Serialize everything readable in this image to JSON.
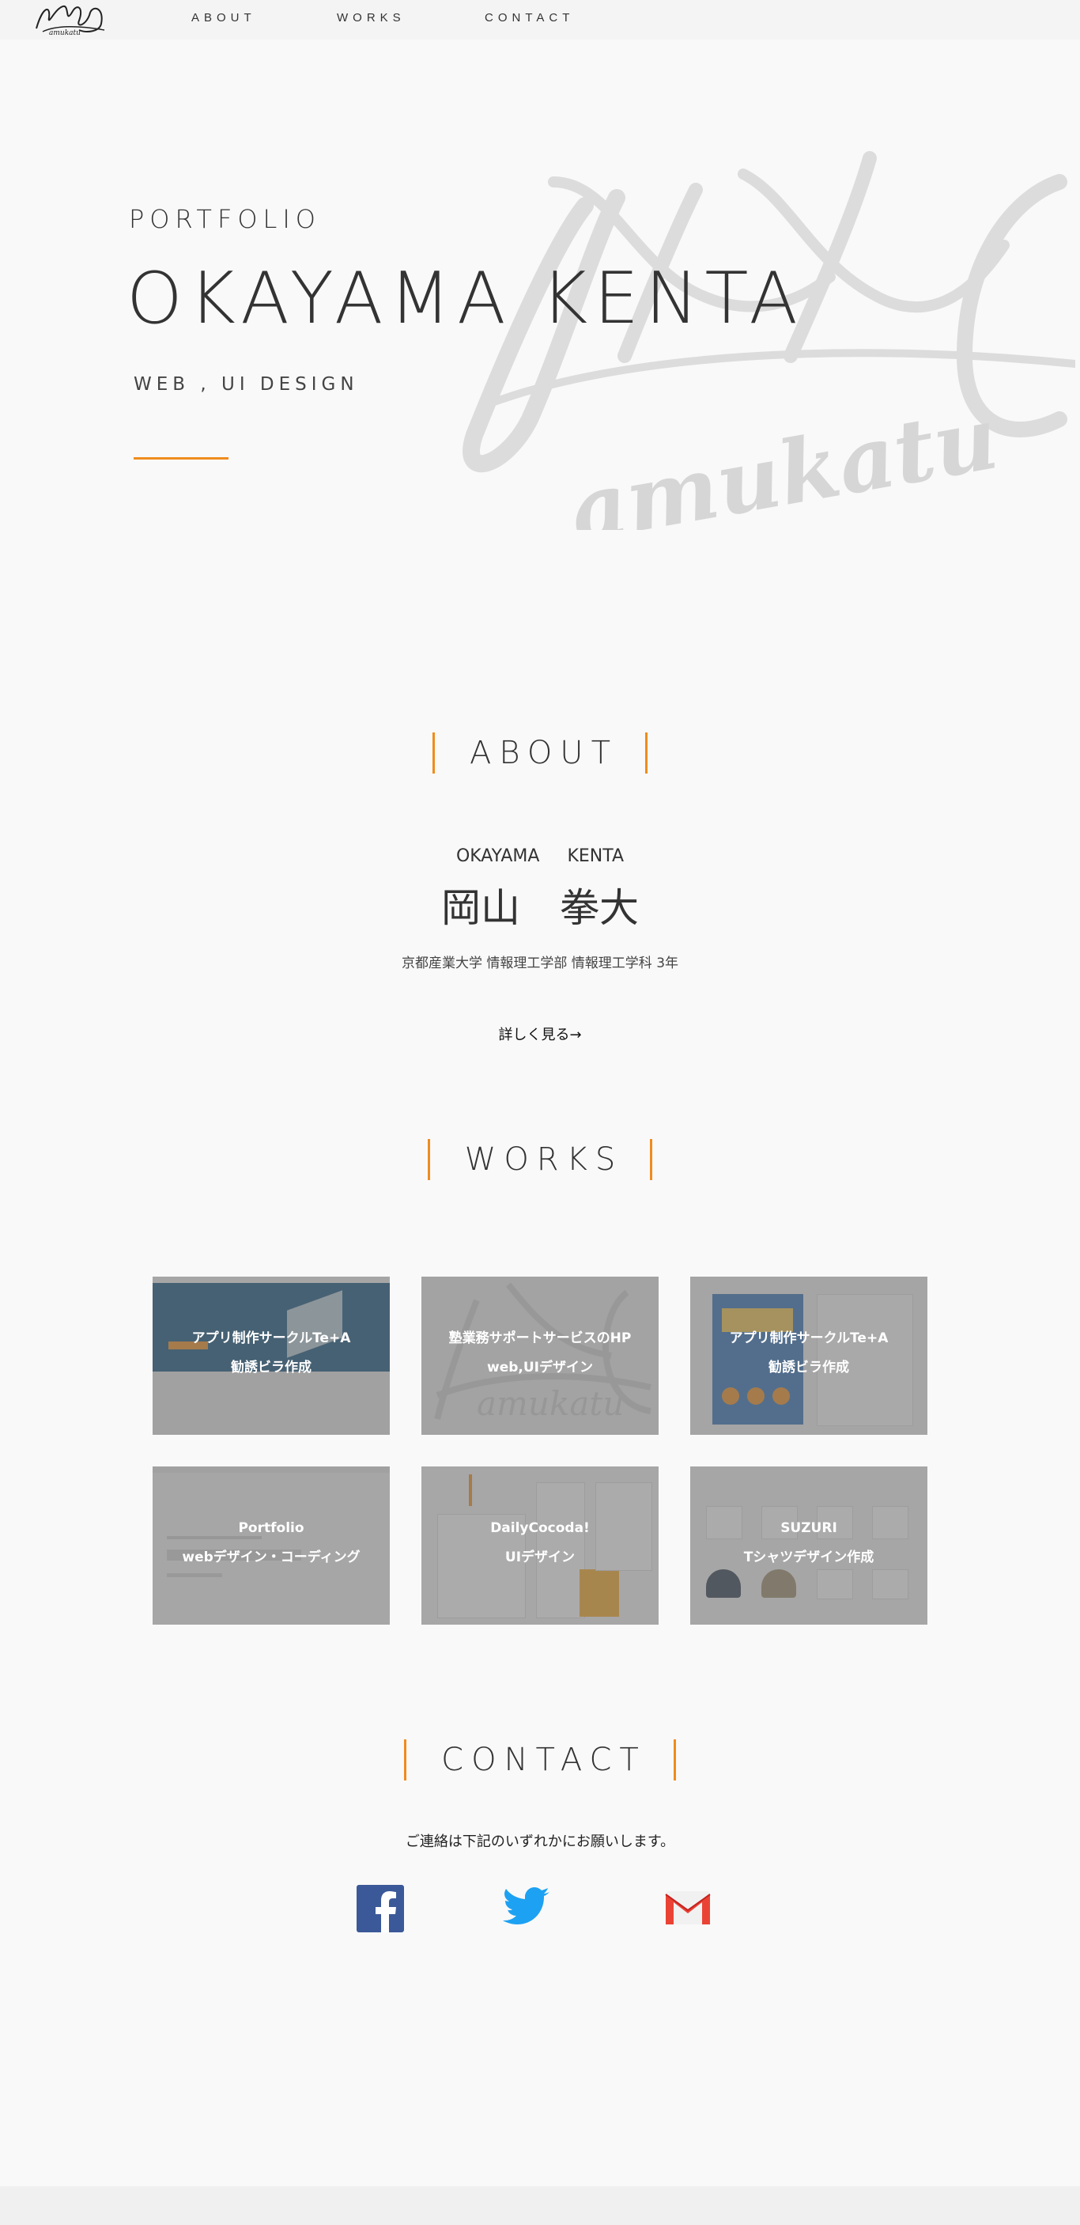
{
  "nav": {
    "items": [
      "ABOUT",
      "WORKS",
      "CONTACT"
    ]
  },
  "hero": {
    "kicker": "PORTFOLIO",
    "name": "OKAYAMA KENTA",
    "subtitle": "WEB , UI  DESIGN"
  },
  "about": {
    "heading": "ABOUT",
    "roman_name": "OKAYAMA KENTA",
    "kanji_name": "岡山　拳大",
    "school": "京都産業大学 情報理工学部 情報理工学科 3年",
    "more_link": "詳しく見る→"
  },
  "works": {
    "heading": "WORKS",
    "items": [
      {
        "line1": "アプリ制作サークルTe+A",
        "line2": "勧誘ビラ作成"
      },
      {
        "line1": "塾業務サポートサービスのHP",
        "line2": "web,UIデザイン"
      },
      {
        "line1": "アプリ制作サークルTe+A",
        "line2": "勧誘ビラ作成"
      },
      {
        "line1": "Portfolio",
        "line2": "webデザイン・コーディング"
      },
      {
        "line1": "DailyCocoda!",
        "line2": "UIデザイン"
      },
      {
        "line1": "SUZURI",
        "line2": "Tシャツデザイン作成"
      }
    ]
  },
  "contact": {
    "heading": "CONTACT",
    "message": "ご連絡は下記のいずれかにお願いします。"
  },
  "colors": {
    "accent": "#f08c1e",
    "facebook": "#3b5998",
    "twitter": "#1da1f2",
    "gmail": "#ea4335"
  },
  "icons": [
    "logo-icon",
    "facebook-icon",
    "twitter-icon",
    "gmail-icon"
  ]
}
